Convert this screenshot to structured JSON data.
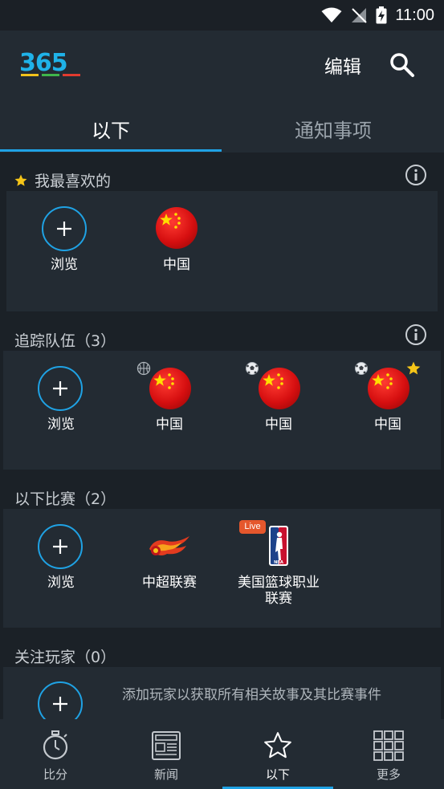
{
  "status_bar": {
    "time": "11:00"
  },
  "header": {
    "logo_text": "365",
    "edit_label": "编辑",
    "search_icon": "search-icon"
  },
  "tabs": [
    {
      "label": "以下",
      "active": true
    },
    {
      "label": "通知事项",
      "active": false
    }
  ],
  "favorites": {
    "title": "我最喜欢的",
    "items": [
      {
        "label": "浏览",
        "icon": "plus-icon"
      },
      {
        "label": "中国",
        "icon": "china-flag-icon"
      }
    ]
  },
  "teams": {
    "title": "追踪队伍（3）",
    "items": [
      {
        "label": "浏览",
        "icon": "plus-icon"
      },
      {
        "label": "中国",
        "icon": "china-flag-icon",
        "sport": "basketball-icon"
      },
      {
        "label": "中国",
        "icon": "china-flag-icon",
        "sport": "soccer-ball-icon"
      },
      {
        "label": "中国",
        "icon": "china-flag-icon",
        "sport": "soccer-ball-icon",
        "favorite": true
      }
    ]
  },
  "competitions": {
    "title": "以下比赛（2）",
    "items": [
      {
        "label": "浏览",
        "icon": "plus-icon"
      },
      {
        "label": "中超联赛",
        "icon": "csl-logo-icon"
      },
      {
        "label_line1": "美国篮球职业",
        "label_line2": "联赛",
        "icon": "nba-logo-icon",
        "badge": "Live"
      }
    ]
  },
  "players": {
    "title": "关注玩家（0）",
    "hint": "添加玩家以获取所有相关故事及其比赛事件"
  },
  "bottom_nav": [
    {
      "label": "比分",
      "icon": "stopwatch-icon",
      "active": false
    },
    {
      "label": "新闻",
      "icon": "newspaper-icon",
      "active": false
    },
    {
      "label": "以下",
      "icon": "star-outline-icon",
      "active": true
    },
    {
      "label": "更多",
      "icon": "grid-icon",
      "active": false
    }
  ],
  "colors": {
    "accent": "#1fa2e4",
    "background": "#1b2127",
    "card": "#232b33",
    "star": "#f5c518",
    "live": "#e5572c"
  }
}
